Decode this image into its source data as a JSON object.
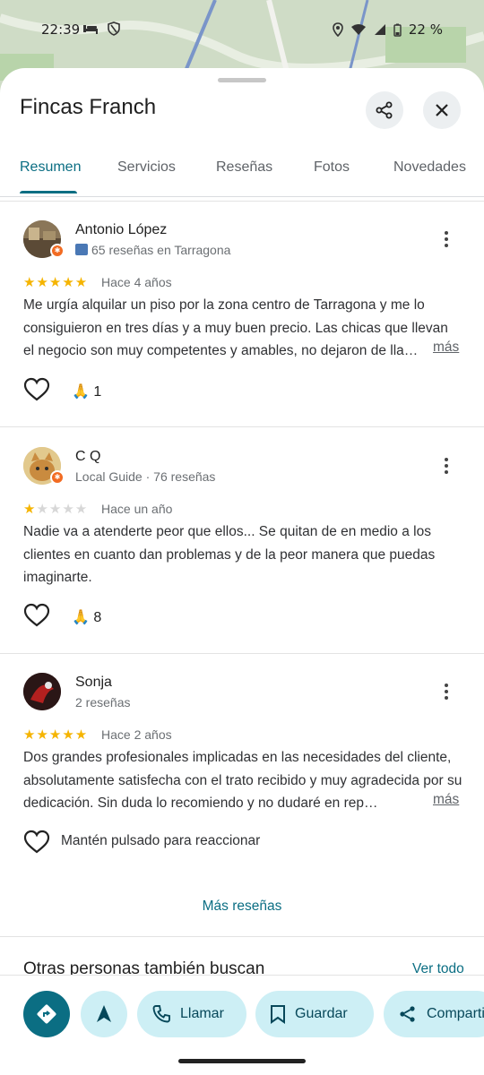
{
  "status_bar": {
    "time": "22:39",
    "battery": "22 %"
  },
  "place": {
    "title": "Fincas Franch"
  },
  "tabs": [
    {
      "label": "Resumen",
      "active": true
    },
    {
      "label": "Servicios",
      "active": false
    },
    {
      "label": "Reseñas",
      "active": false
    },
    {
      "label": "Fotos",
      "active": false
    },
    {
      "label": "Novedades",
      "active": false
    }
  ],
  "reviews": [
    {
      "author": "Antonio López",
      "meta": "65 reseñas en Tarragona",
      "rating": 5,
      "when": "Hace 4 años",
      "text": "Me urgía alquilar un piso por la zona centro de Tarragona y me lo consiguieron en tres días y a muy buen precio. Las chicas que llevan el negocio son muy competentes y amables, no dejaron de lla…",
      "more_label": "más",
      "reaction_count": "1"
    },
    {
      "author": "C Q",
      "meta": "Local Guide · 76 reseñas",
      "rating": 1,
      "when": "Hace un año",
      "text": "Nadie va a atenderte peor que ellos... Se quitan de en medio a los clientes en cuanto dan problemas y de la peor manera que puedas imaginarte.",
      "reaction_count": "8"
    },
    {
      "author": "Sonja",
      "meta": "2 reseñas",
      "rating": 5,
      "when": "Hace 2 años",
      "text": "Dos grandes profesionales implicadas en las necesidades del cliente, absolutamente satisfecha con el trato recibido y muy agradecida por su dedicación. Sin duda lo recomiendo y no dudaré en rep…",
      "more_label": "más",
      "reaction_hint": "Mantén pulsado para reaccionar"
    }
  ],
  "more_reviews_label": "Más reseñas",
  "related": {
    "title": "Otras personas también buscan",
    "see_all": "Ver todo"
  },
  "actions": {
    "call": "Llamar",
    "save": "Guardar",
    "share": "Compartir"
  },
  "colors": {
    "accent": "#0b6e83",
    "pill_bg": "#cdeff5",
    "star": "#f5b400"
  }
}
